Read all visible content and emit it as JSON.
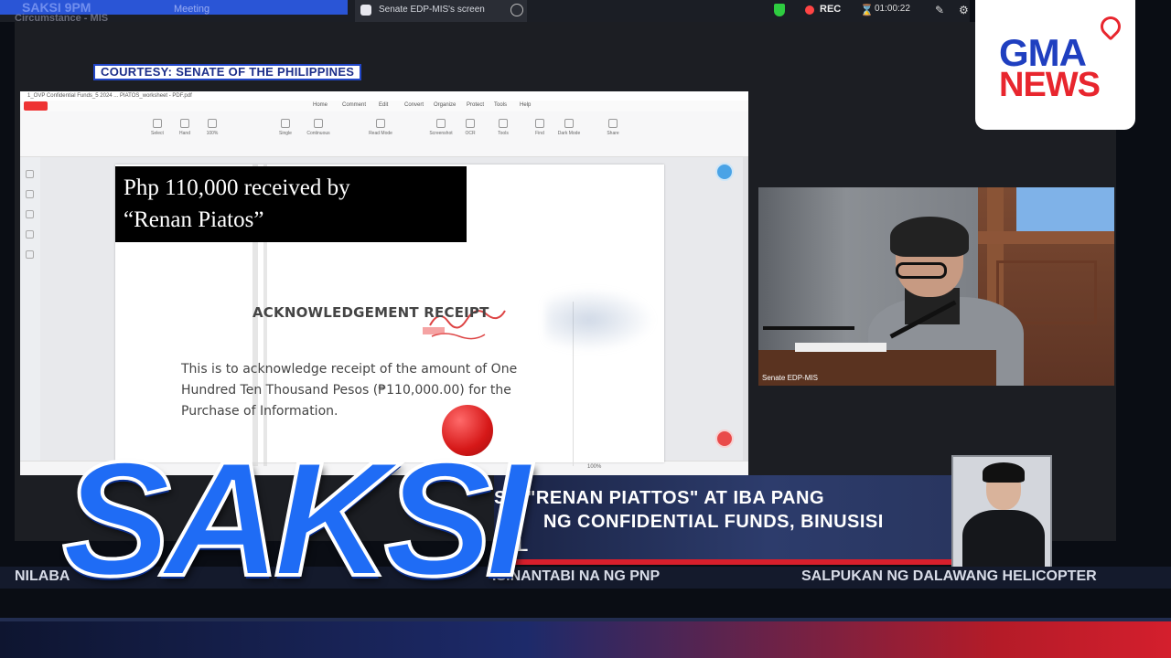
{
  "topbar": {
    "left_text": "SAKSI 9PM",
    "meeting_label": "Meeting",
    "tab_title": "Senate EDP-MIS's screen",
    "rec_label": "REC",
    "timer": "01:00:22",
    "subtitle": "Circumstance - MIS"
  },
  "courtesy": "COURTESY: SENATE OF THE PHILIPPINES",
  "pdf": {
    "window_title": "1_OVP Confidential Funds_5 2024 ... PIATOS_worksheet - PDF.pdf",
    "menu": [
      "Home",
      "Comment",
      "Edit",
      "Convert",
      "Organize",
      "Protect",
      "Tools",
      "Help"
    ],
    "ribbon": [
      "Select",
      "Hand",
      "Zoom",
      "Single",
      "Continuous",
      "Read Mode",
      "Screenshot",
      "OCR",
      "Tools",
      "Find",
      "Dark Mode",
      "Share"
    ],
    "zoom": "100%",
    "overlay_caption_line1": "Php 110,000 received  by",
    "overlay_caption_line2": "“Renan Piatos”",
    "receipt_title": "ACKNOWLEDGEMENT RECEIPT",
    "receipt_body_line1": "This is to acknowledge receipt of the amount of One",
    "receipt_body_line2": "Hundred Ten Thousand Pesos (₱110,000.00) for the",
    "receipt_body_line3": "Purchase of Information."
  },
  "video": {
    "label": "Senate EDP-MIS"
  },
  "brand": {
    "gma_line1": "GMA",
    "gma_line2": "NEWS",
    "show": "SAKSI",
    "brand_blue": "#1f6cf5",
    "brand_red": "#d61818"
  },
  "lower_third": {
    "headline_line1": "S\", \"RENAN PIATTOS\" AT IBA PANG",
    "headline_line2": "NG CONFIDENTIAL FUNDS, BINUSISI",
    "headline_line3": "AL"
  },
  "ticker": {
    "item1": "NILABA",
    "item2": "ISINANTABI NA NG PNP",
    "item3": "SALPUKAN NG DALAWANG HELICOPTER"
  }
}
